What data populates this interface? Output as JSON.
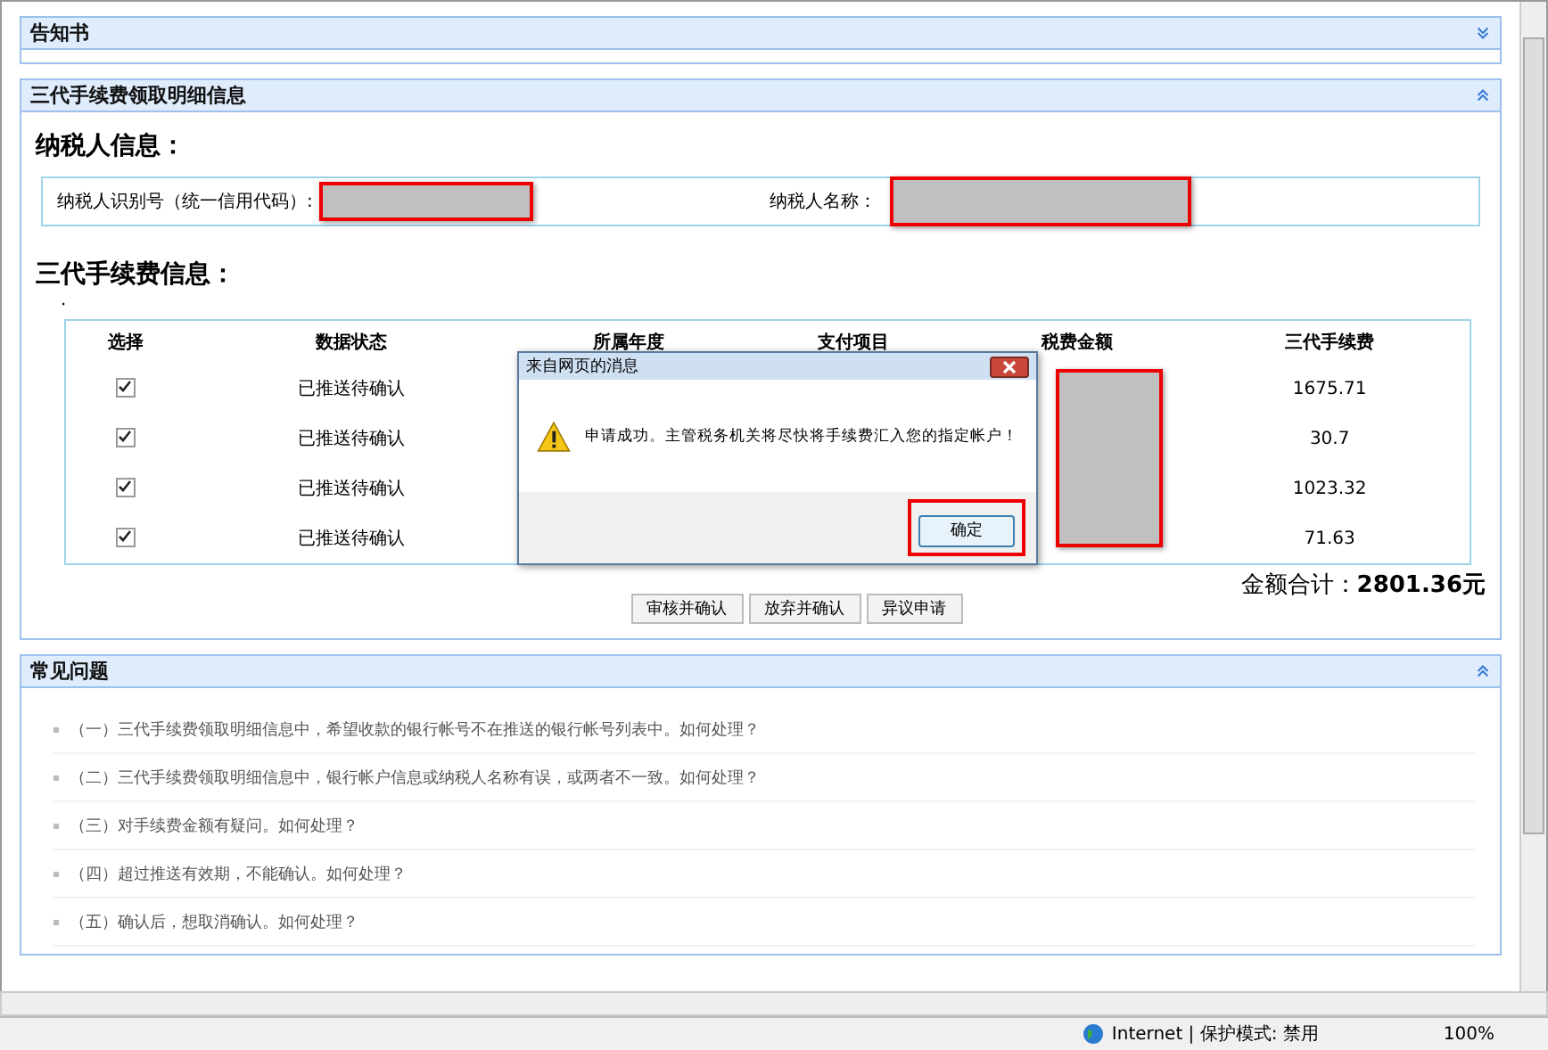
{
  "panels": [
    {
      "title": "告知书",
      "expanded": false
    },
    {
      "title": "三代手续费领取明细信息",
      "expanded": true
    }
  ],
  "taxpayer": {
    "heading": "纳税人信息：",
    "id_label": "纳税人识别号（统一信用代码）:",
    "name_label": "纳税人名称："
  },
  "fees": {
    "heading": "三代手续费信息：",
    "bullet": "·",
    "columns": [
      "选择",
      "数据状态",
      "所属年度",
      "支付项目",
      "税费金额",
      "三代手续费"
    ],
    "rows": [
      {
        "checked": true,
        "status": "已推送待确认",
        "fee": "1675.71"
      },
      {
        "checked": true,
        "status": "已推送待确认",
        "fee": "30.7"
      },
      {
        "checked": true,
        "status": "已推送待确认",
        "fee": "1023.32"
      },
      {
        "checked": true,
        "status": "已推送待确认",
        "fee": "71.63"
      }
    ],
    "total_label": "金额合计：",
    "total": "2801.36元",
    "buttons": [
      "审核并确认",
      "放弃并确认",
      "异议申请"
    ]
  },
  "dialog": {
    "title": "来自网页的消息",
    "message": "申请成功。主管税务机关将尽快将手续费汇入您的指定帐户！",
    "ok": "确定"
  },
  "faq": {
    "title": "常见问题",
    "expanded": true,
    "items": [
      "（一）三代手续费领取明细信息中，希望收款的银行帐号不在推送的银行帐号列表中。如何处理？",
      "（二）三代手续费领取明细信息中，银行帐户信息或纳税人名称有误，或两者不一致。如何处理？",
      "（三）对手续费金额有疑问。如何处理？",
      "（四）超过推送有效期，不能确认。如何处理？",
      "（五）确认后，想取消确认。如何处理？"
    ]
  },
  "status_bar": {
    "zone": "Internet | 保护模式: 禁用",
    "zoom": "100%"
  }
}
